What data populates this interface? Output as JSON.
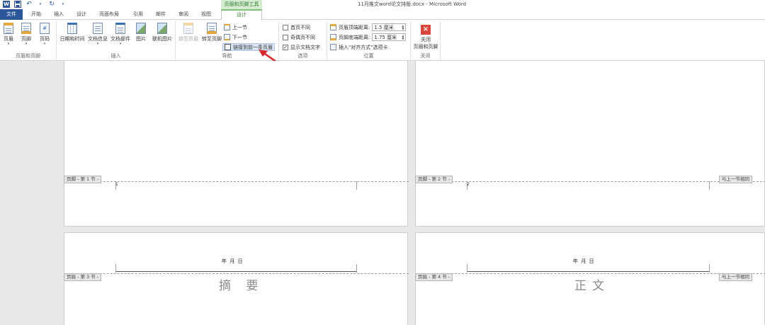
{
  "title_bar": {
    "doc_title": "11月推文word论文排版.docx - Microsoft Word",
    "context_tools_label": "页眉和页脚工具"
  },
  "quick_access": {
    "app_icon": "W",
    "save_icon": "save-icon",
    "undo_icon": "undo-icon",
    "redo_icon": "redo-icon",
    "customize_icon": "dropdown-icon"
  },
  "tabs": [
    {
      "label": "文件"
    },
    {
      "label": "开始"
    },
    {
      "label": "插入"
    },
    {
      "label": "设计"
    },
    {
      "label": "页面布局"
    },
    {
      "label": "引用"
    },
    {
      "label": "邮件"
    },
    {
      "label": "审阅"
    },
    {
      "label": "视图"
    },
    {
      "label": "设计"
    }
  ],
  "ribbon": {
    "header_footer": {
      "label": "页眉和页脚",
      "header_btn": "页眉",
      "footer_btn": "页脚",
      "page_number_btn": "页码"
    },
    "insert": {
      "label": "插入",
      "datetime_btn": "日期和时间",
      "docinfo_btn": "文档信息",
      "quickparts_btn": "文档部件",
      "picture_btn": "图片",
      "online_picture_btn": "联机图片"
    },
    "navigation": {
      "label": "导航",
      "goto_header_btn": "转至页眉",
      "goto_footer_btn": "转至页脚",
      "prev_btn": "上一节",
      "next_btn": "下一节",
      "link_prev_btn": "链接到前一条页眉"
    },
    "options": {
      "label": "选项",
      "first_page_diff": "首页不同",
      "odd_even_diff": "奇偶页不同",
      "show_doc_text": "显示文档文字",
      "show_doc_text_checked": "✓"
    },
    "position": {
      "label": "位置",
      "header_top_label": "页眉顶端距离:",
      "header_top_value": "1.5 厘米",
      "footer_bottom_label": "页脚底端距离:",
      "footer_bottom_value": "1.75 厘米",
      "insert_align_tab": "插入\"对齐方式\"选项卡"
    },
    "close": {
      "label": "关闭",
      "close_btn_line1": "关闭",
      "close_btn_line2": "页眉和页脚"
    }
  },
  "pages": {
    "p1": {
      "footer_tag": "页脚 - 第 1 节 -",
      "page_number": "1"
    },
    "p2": {
      "footer_tag": "页脚 - 第 2 节 -",
      "page_number": "2",
      "same_as_prev": "与上一节相同"
    },
    "p3": {
      "header_tag": "页眉 - 第 3 节 -",
      "date": "年    月    日",
      "heading": "摘 要"
    },
    "p4": {
      "header_tag": "页眉 - 第 4 节 -",
      "date": "年    月    日",
      "heading": "正文",
      "same_as_prev": "与上一节相同"
    }
  },
  "accent_colors": {
    "file_tab": "#2b579a",
    "context_tab": "#2e7d32",
    "annotation_arrow": "#d9262b"
  }
}
